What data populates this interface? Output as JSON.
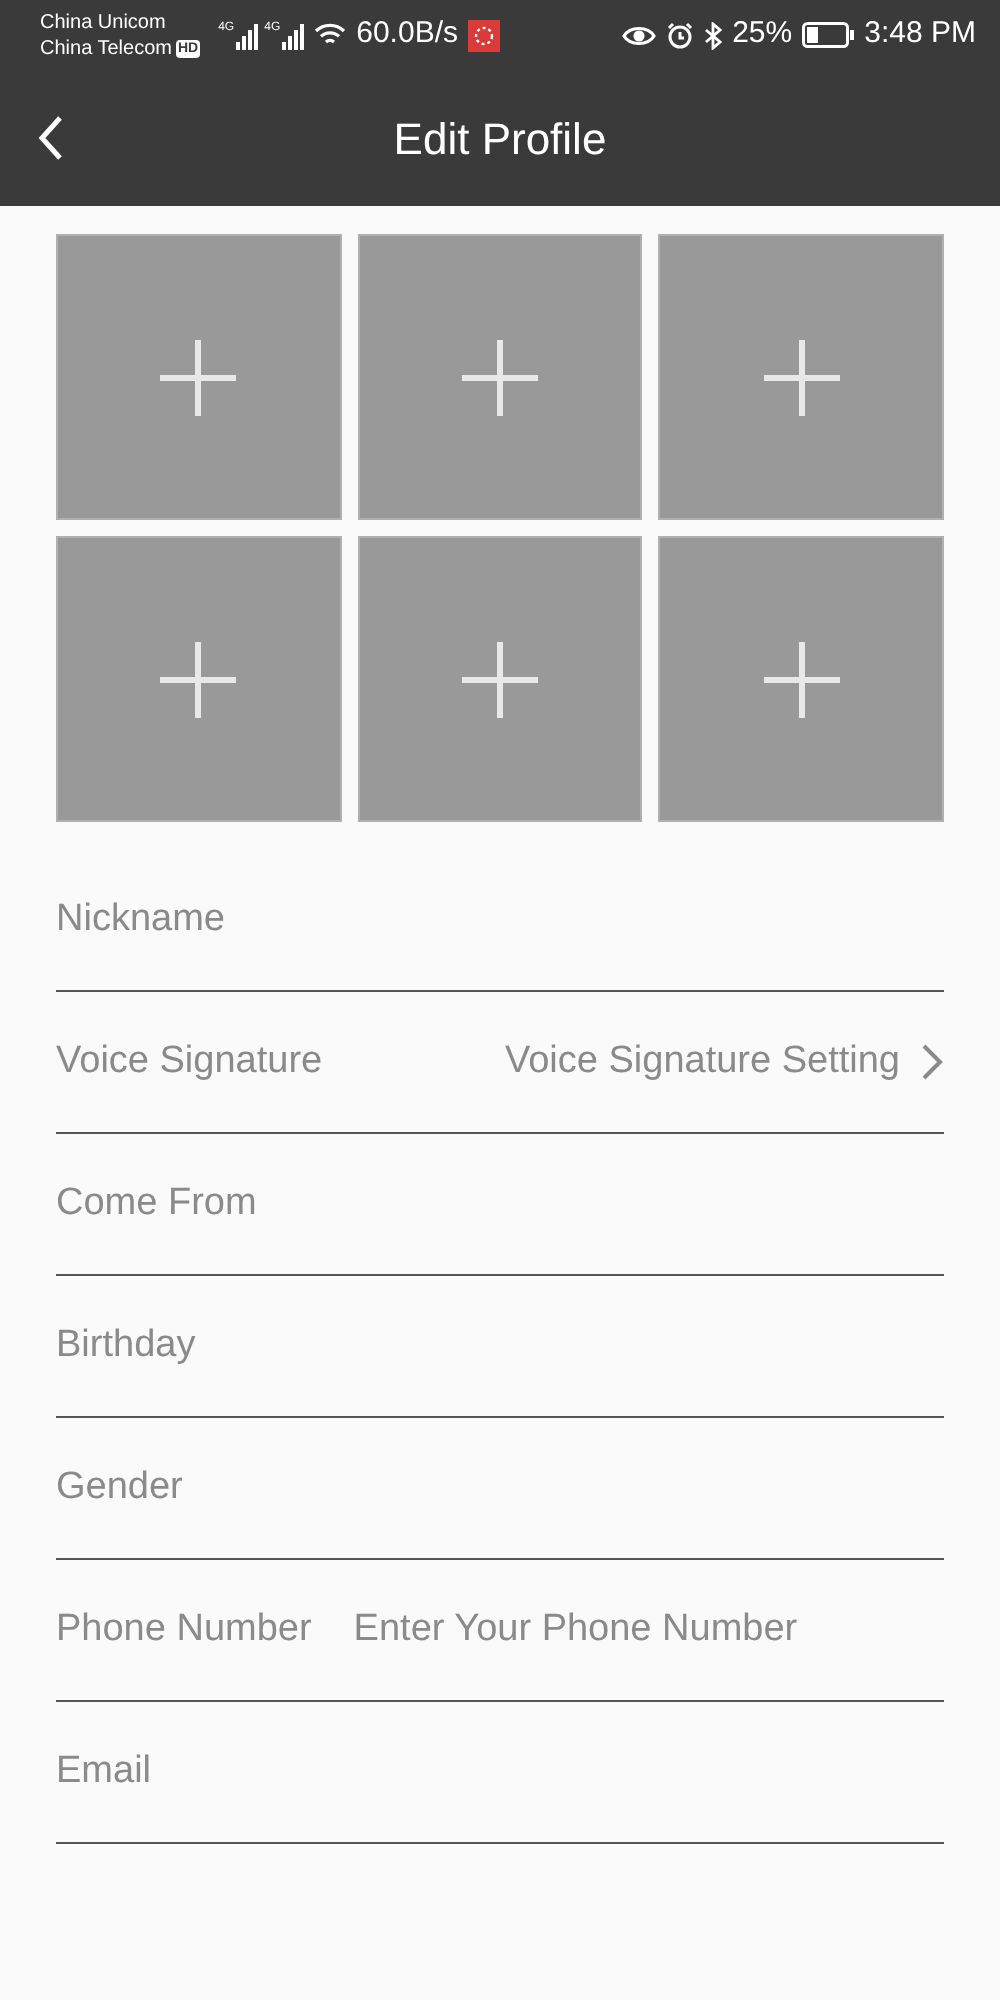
{
  "status_bar": {
    "carriers": [
      "China Unicom",
      "China Telecom"
    ],
    "hd_badge": "HD",
    "networks": [
      "4G",
      "4G"
    ],
    "speed": "60.0B/s",
    "battery": "25%",
    "time": "3:48 PM"
  },
  "header": {
    "title": "Edit Profile"
  },
  "photos": [
    {
      "kind": "add"
    },
    {
      "kind": "add"
    },
    {
      "kind": "add"
    },
    {
      "kind": "add"
    },
    {
      "kind": "add"
    },
    {
      "kind": "add"
    }
  ],
  "fields": [
    {
      "kind": "text",
      "label": "Nickname"
    },
    {
      "kind": "link",
      "label": "Voice Signature",
      "value": "Voice Signature Setting"
    },
    {
      "kind": "text",
      "label": "Come From"
    },
    {
      "kind": "text",
      "label": "Birthday"
    },
    {
      "kind": "text",
      "label": "Gender"
    },
    {
      "kind": "input",
      "label": "Phone Number",
      "placeholder": "Enter Your Phone Number"
    },
    {
      "kind": "text",
      "label": "Email"
    }
  ]
}
